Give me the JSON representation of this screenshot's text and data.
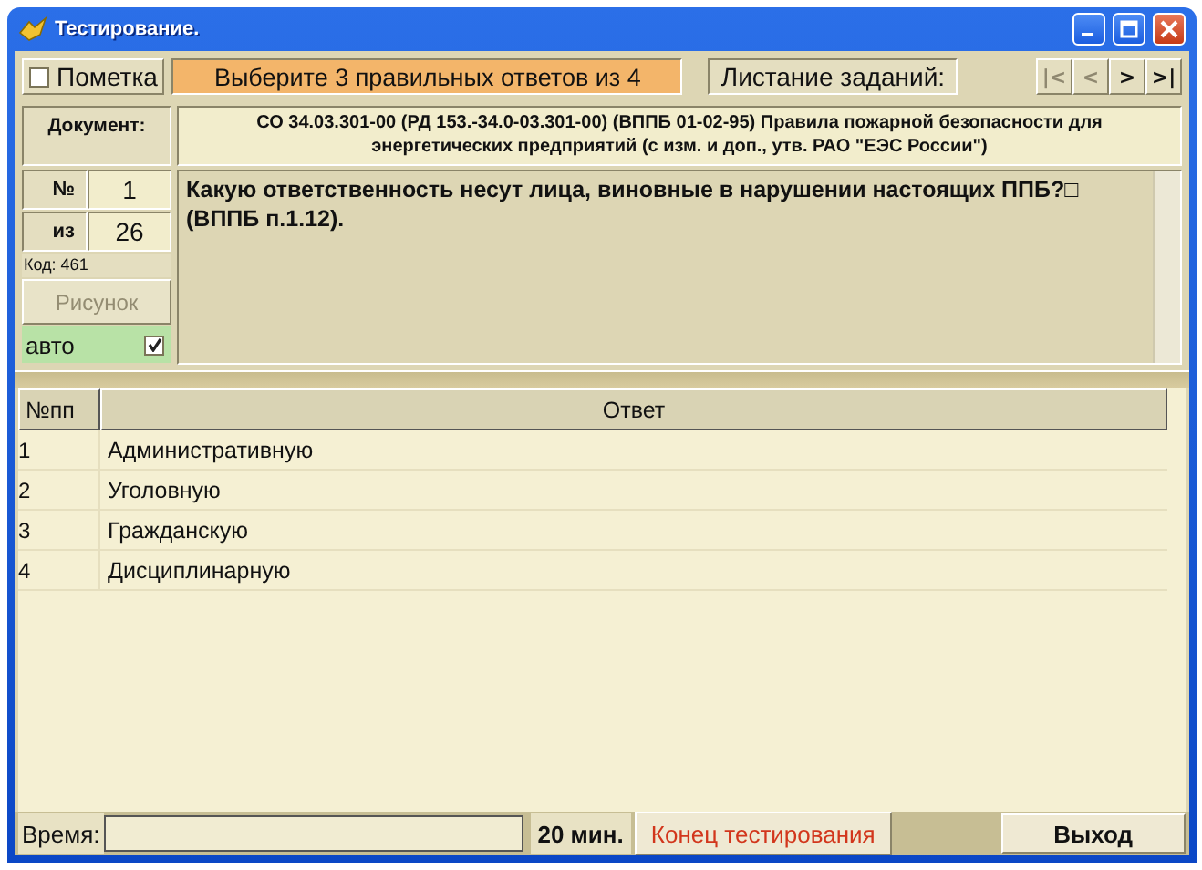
{
  "window": {
    "title": "Тестирование."
  },
  "toolbar": {
    "mark": {
      "label": "Пометка",
      "checked": false
    },
    "instruction": "Выберите 3 правильных ответов из 4",
    "paging_label": "Листание заданий:",
    "nav_buttons": [
      {
        "label": "|<",
        "disabled": true
      },
      {
        "label": "<",
        "disabled": true
      },
      {
        "label": ">",
        "disabled": false
      },
      {
        "label": ">|",
        "disabled": false
      }
    ]
  },
  "document": {
    "label": "Документ:",
    "text": "СО 34.03.301-00 (РД 153.-34.0-03.301-00)  (ВППБ 01-02-95) Правила пожарной безопасности для энергетических предприятий (с изм. и доп., утв. РАО \"ЕЭС России\")"
  },
  "question": {
    "number_label": "№",
    "number": "1",
    "total_label": "из",
    "total": "26",
    "code": "Код: 461",
    "picture_button": {
      "label": "Рисунок",
      "disabled": true
    },
    "auto": {
      "label": "авто",
      "checked": true
    },
    "text": "Какую ответственность несут лица, виновные в нарушении настоящих ППБ?□ (ВППБ п.1.12)."
  },
  "table": {
    "columns": [
      "№пп",
      "Ответ"
    ],
    "rows": [
      {
        "number": "1",
        "answer": "Административную"
      },
      {
        "number": "2",
        "answer": "Уголовную"
      },
      {
        "number": "3",
        "answer": "Гражданскую"
      },
      {
        "number": "4",
        "answer": "Дисциплинарную"
      }
    ]
  },
  "status_bar": {
    "time_label": "Время:",
    "limit": "20 мин.",
    "finish_button": "Конец тестирования",
    "exit_button": "Выход"
  }
}
